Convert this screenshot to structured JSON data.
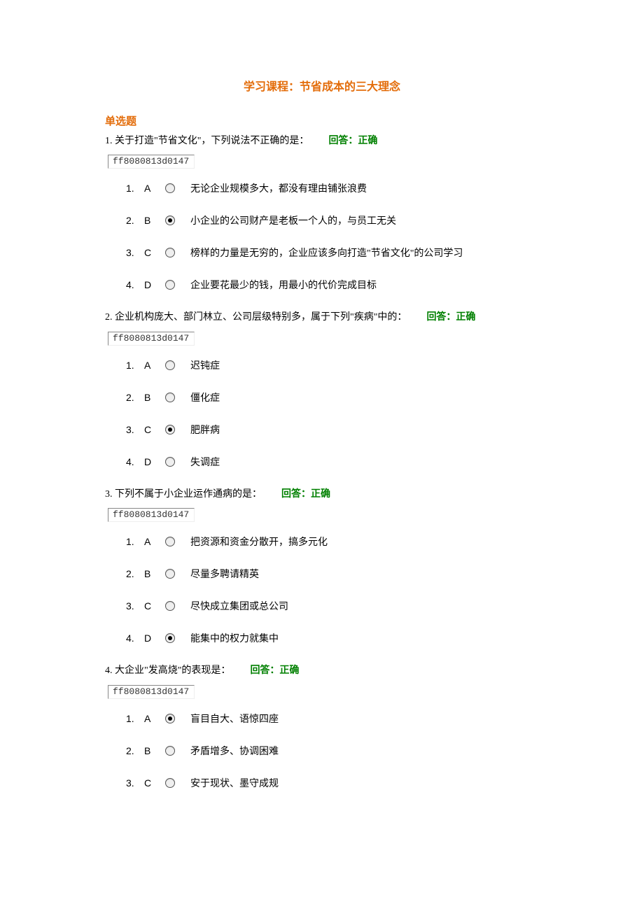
{
  "title": "学习课程：节省成本的三大理念",
  "section_heading": "单选题",
  "code_text": "ff8080813d0147",
  "answer_prefix": "回答：",
  "answer_value": "正确",
  "questions": [
    {
      "num": "1",
      "stem": "关于打造\"节省文化\"，下列说法不正确的是：",
      "selected": "B",
      "options": [
        {
          "idx": "1.",
          "letter": "A",
          "text": "无论企业规模多大，都没有理由铺张浪费"
        },
        {
          "idx": "2.",
          "letter": "B",
          "text": "小企业的公司财产是老板一个人的，与员工无关"
        },
        {
          "idx": "3.",
          "letter": "C",
          "text": "榜样的力量是无穷的，企业应该多向打造\"节省文化\"的公司学习"
        },
        {
          "idx": "4.",
          "letter": "D",
          "text": "企业要花最少的钱，用最小的代价完成目标"
        }
      ]
    },
    {
      "num": "2",
      "stem": "企业机构庞大、部门林立、公司层级特别多，属于下列\"疾病\"中的：",
      "selected": "C",
      "options": [
        {
          "idx": "1.",
          "letter": "A",
          "text": "迟钝症"
        },
        {
          "idx": "2.",
          "letter": "B",
          "text": "僵化症"
        },
        {
          "idx": "3.",
          "letter": "C",
          "text": "肥胖病"
        },
        {
          "idx": "4.",
          "letter": "D",
          "text": "失调症"
        }
      ]
    },
    {
      "num": "3",
      "stem": "下列不属于小企业运作通病的是：",
      "selected": "D",
      "options": [
        {
          "idx": "1.",
          "letter": "A",
          "text": "把资源和资金分散开，搞多元化"
        },
        {
          "idx": "2.",
          "letter": "B",
          "text": "尽量多聘请精英"
        },
        {
          "idx": "3.",
          "letter": "C",
          "text": "尽快成立集团或总公司"
        },
        {
          "idx": "4.",
          "letter": "D",
          "text": "能集中的权力就集中"
        }
      ]
    },
    {
      "num": "4",
      "stem": "大企业\"发高烧\"的表现是：",
      "selected": "A",
      "options": [
        {
          "idx": "1.",
          "letter": "A",
          "text": "盲目自大、语惊四座"
        },
        {
          "idx": "2.",
          "letter": "B",
          "text": "矛盾增多、协调困难"
        },
        {
          "idx": "3.",
          "letter": "C",
          "text": "安于现状、墨守成规"
        }
      ]
    }
  ]
}
